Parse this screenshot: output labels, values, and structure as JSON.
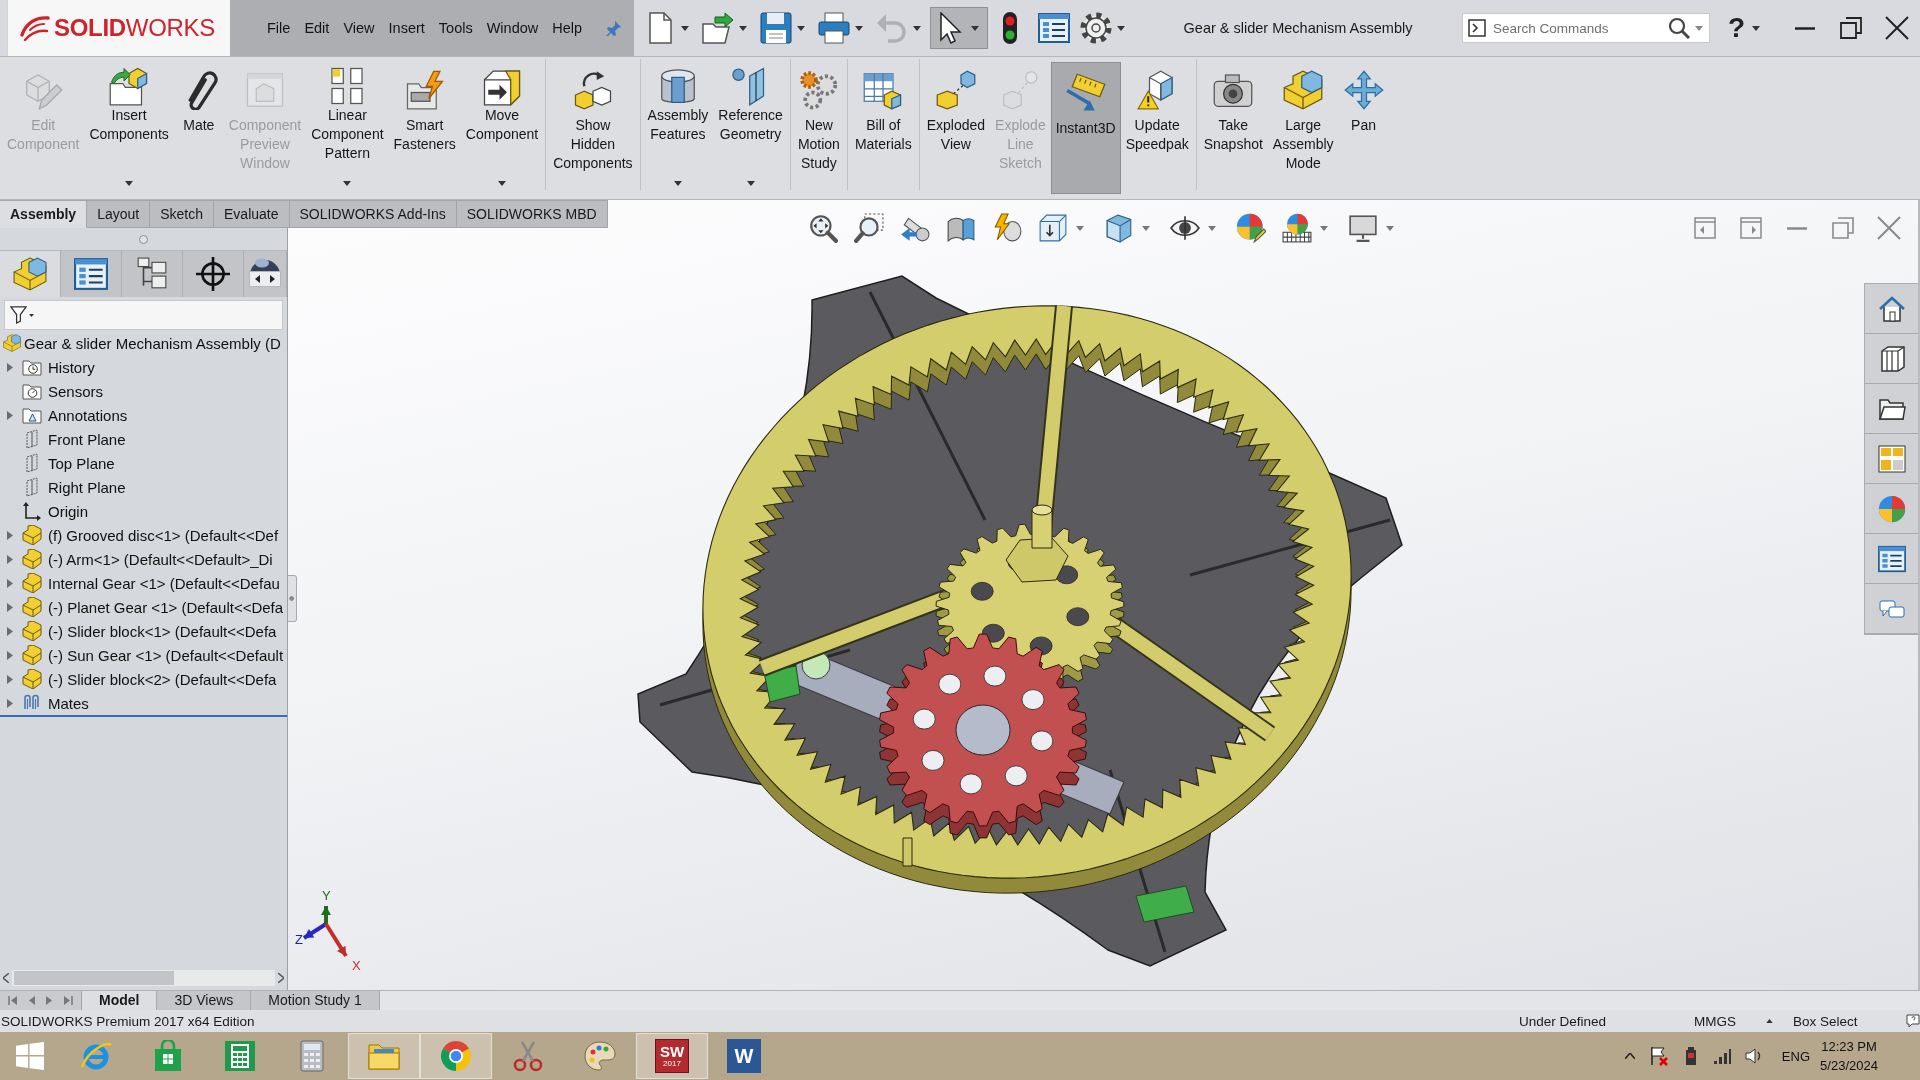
{
  "title_bar": {
    "logo": "**SOLID**WORKS",
    "menu": [
      "File",
      "Edit",
      "View",
      "Insert",
      "Tools",
      "Window",
      "Help"
    ],
    "quick_access": [
      {
        "has_menu": true,
        "disabled": false,
        "on": false
      },
      {
        "has_menu": true,
        "disabled": false,
        "on": false
      },
      {
        "has_menu": true,
        "disabled": false,
        "on": false
      },
      {
        "has_menu": true,
        "disabled": false,
        "on": false
      },
      {
        "has_menu": true,
        "disabled": true,
        "on": false
      },
      {
        "has_menu": true,
        "disabled": false,
        "on": true
      },
      {
        "has_menu": false,
        "disabled": false,
        "on": false
      },
      {
        "has_menu": false,
        "disabled": false,
        "on": false
      },
      {
        "has_menu": true,
        "disabled": false,
        "on": false
      }
    ],
    "document_title": "Gear & slider Mechanism Assembly",
    "search": {
      "placeholder": "Search Commands"
    },
    "help": "?"
  },
  "ribbon": {
    "groups": [
      {
        "buttons": [
          {
            "label": "Edit\nComponent",
            "disabled": true,
            "on": false,
            "has_menu": false
          },
          {
            "label": "Insert\nComponents",
            "disabled": false,
            "on": false,
            "has_menu": true
          },
          {
            "label": "Mate",
            "disabled": false,
            "on": false,
            "has_menu": false
          },
          {
            "label": "Component\nPreview\nWindow",
            "disabled": true,
            "on": false,
            "has_menu": false
          },
          {
            "label": "Linear\nComponent\nPattern",
            "disabled": false,
            "on": false,
            "has_menu": true
          },
          {
            "label": "Smart\nFasteners",
            "disabled": false,
            "on": false,
            "has_menu": false
          },
          {
            "label": "Move\nComponent",
            "disabled": false,
            "on": false,
            "has_menu": true
          }
        ]
      },
      {
        "buttons": [
          {
            "label": "Show\nHidden\nComponents",
            "disabled": false,
            "on": false,
            "has_menu": false
          }
        ]
      },
      {
        "buttons": [
          {
            "label": "Assembly\nFeatures",
            "disabled": false,
            "on": false,
            "has_menu": true
          },
          {
            "label": "Reference\nGeometry",
            "disabled": false,
            "on": false,
            "has_menu": true
          }
        ]
      },
      {
        "buttons": [
          {
            "label": "New\nMotion\nStudy",
            "disabled": false,
            "on": false,
            "has_menu": false
          }
        ]
      },
      {
        "buttons": [
          {
            "label": "Bill of\nMaterials",
            "disabled": false,
            "on": false,
            "has_menu": false
          }
        ]
      },
      {
        "buttons": [
          {
            "label": "Exploded\nView",
            "disabled": false,
            "on": false,
            "has_menu": false
          },
          {
            "label": "Explode\nLine\nSketch",
            "disabled": true,
            "on": false,
            "has_menu": false
          },
          {
            "label": "Instant3D",
            "disabled": false,
            "on": true,
            "has_menu": false
          },
          {
            "label": "Update\nSpeedpak",
            "disabled": false,
            "on": false,
            "has_menu": false
          }
        ]
      },
      {
        "buttons": [
          {
            "label": "Take\nSnapshot",
            "disabled": false,
            "on": false,
            "has_menu": false
          },
          {
            "label": "Large\nAssembly\nMode",
            "disabled": false,
            "on": false,
            "has_menu": false
          },
          {
            "label": "Pan",
            "disabled": false,
            "on": false,
            "has_menu": false
          }
        ]
      }
    ]
  },
  "command_tabs": [
    {
      "label": "Assembly",
      "selected": true
    },
    {
      "label": "Layout",
      "selected": false
    },
    {
      "label": "Sketch",
      "selected": false
    },
    {
      "label": "Evaluate",
      "selected": false
    },
    {
      "label": "SOLIDWORKS Add-Ins",
      "selected": false
    },
    {
      "label": "SOLIDWORKS MBD",
      "selected": false
    }
  ],
  "feature_manager": {
    "tabs": [
      {
        "selected": true
      },
      {
        "selected": false
      },
      {
        "selected": false
      },
      {
        "selected": false
      },
      {
        "selected": false
      }
    ],
    "tree": {
      "label": "Gear & slider Mechanism Assembly (D",
      "kind": "assembly",
      "children": [
        {
          "label": "History",
          "kind": "history",
          "expandable": true
        },
        {
          "label": "Sensors",
          "kind": "sensors",
          "expandable": false
        },
        {
          "label": "Annotations",
          "kind": "annotations",
          "expandable": true
        },
        {
          "label": "Front Plane",
          "kind": "plane",
          "expandable": false
        },
        {
          "label": "Top Plane",
          "kind": "plane",
          "expandable": false
        },
        {
          "label": "Right Plane",
          "kind": "plane",
          "expandable": false
        },
        {
          "label": "Origin",
          "kind": "origin",
          "expandable": false
        },
        {
          "label": "(f) Grooved disc<1> (Default<<Def",
          "kind": "part",
          "expandable": true
        },
        {
          "label": "(-) Arm<1> (Default<<Default>_Di",
          "kind": "part",
          "expandable": true
        },
        {
          "label": "Internal Gear <1> (Default<<Defau",
          "kind": "part",
          "expandable": true
        },
        {
          "label": "(-) Planet Gear <1> (Default<<Defa",
          "kind": "part",
          "expandable": true
        },
        {
          "label": "(-) Slider block<1> (Default<<Defa",
          "kind": "part",
          "expandable": true
        },
        {
          "label": "(-) Sun Gear <1> (Default<<Default",
          "kind": "part",
          "expandable": true
        },
        {
          "label": "(-) Slider block<2> (Default<<Defa",
          "kind": "part",
          "expandable": true
        },
        {
          "label": "Mates",
          "kind": "mates",
          "expandable": true
        }
      ]
    }
  },
  "graphics_area": {
    "view_toolbar": [
      {
        "has_menu": false
      },
      {
        "has_menu": false
      },
      {
        "has_menu": false
      },
      {
        "has_menu": false
      },
      {
        "has_menu": false
      },
      {
        "has_menu": true
      },
      {
        "has_menu": true
      },
      {
        "has_menu": true
      },
      {
        "has_menu": false
      },
      {
        "has_menu": true
      },
      {
        "has_menu": true
      }
    ],
    "triad": [
      "Y",
      "Z",
      "X"
    ]
  },
  "bottom_tabs": [
    {
      "label": "Model",
      "selected": true
    },
    {
      "label": "3D Views",
      "selected": false
    },
    {
      "label": "Motion Study 1",
      "selected": false
    }
  ],
  "status_bar": {
    "product": "SOLIDWORKS Premium 2017 x64 Edition",
    "state": "Under Defined",
    "units": "MMGS",
    "mode": "Box Select"
  },
  "taskbar": {
    "apps": [
      {
        "running": false
      },
      {
        "running": false
      },
      {
        "running": false
      },
      {
        "running": false
      },
      {
        "running": true
      },
      {
        "running": true
      },
      {
        "running": false
      },
      {
        "running": false
      },
      {
        "running": true,
        "glyph": "SW",
        "version": "2017"
      },
      {
        "running": false,
        "glyph": "W"
      }
    ],
    "language": "ENG",
    "time": "12:23 PM",
    "date": "5/23/2024"
  }
}
